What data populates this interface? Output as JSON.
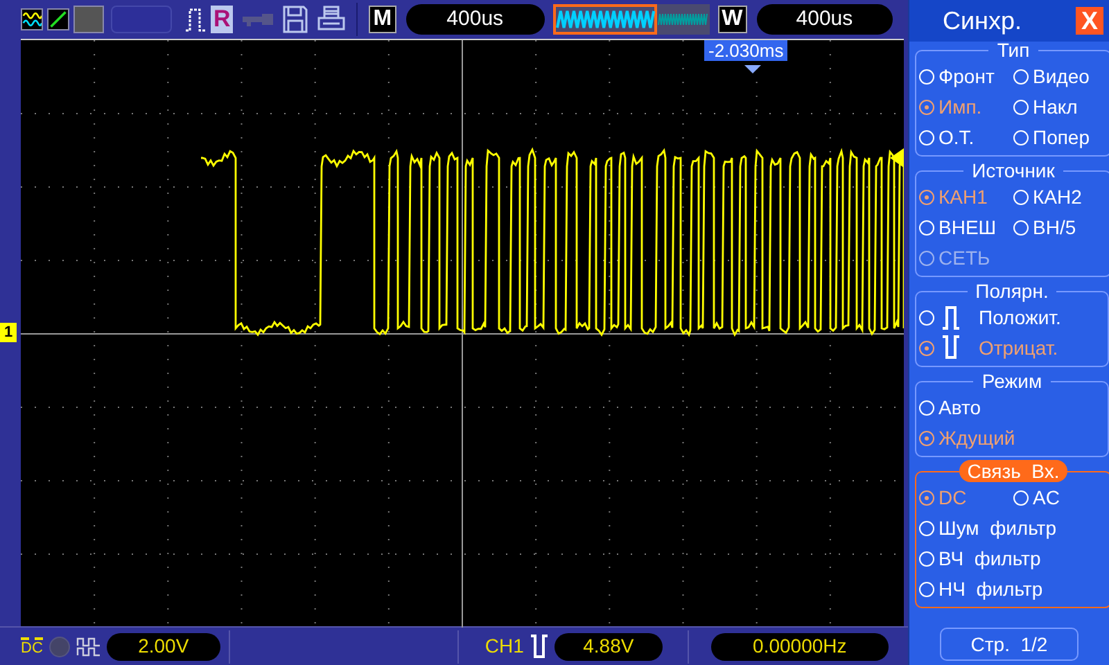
{
  "toolbar": {
    "ref_label": "R",
    "mode_label": "M",
    "time_base": "400us",
    "window_label": "W",
    "window_time": "400us"
  },
  "screen": {
    "trigger_position": "-2.030ms",
    "channel_marker": "1"
  },
  "trigger_panel": {
    "title": "Синхр.",
    "close": "X",
    "sections": [
      {
        "title": "Тип",
        "highlighted": false,
        "rows": [
          [
            {
              "label": "Фронт",
              "kind": "plain",
              "selected": false,
              "disabled": false
            },
            {
              "label": "Видео",
              "kind": "plain",
              "selected": false,
              "disabled": false
            }
          ],
          [
            {
              "label": "Имп.",
              "kind": "plain",
              "selected": true,
              "disabled": false
            },
            {
              "label": "Накл",
              "kind": "plain",
              "selected": false,
              "disabled": false
            }
          ],
          [
            {
              "label": "О.Т.",
              "kind": "plain",
              "selected": false,
              "disabled": false
            },
            {
              "label": "Попер",
              "kind": "plain",
              "selected": false,
              "disabled": false
            }
          ]
        ]
      },
      {
        "title": "Источник",
        "highlighted": false,
        "rows": [
          [
            {
              "label": "КАН1",
              "kind": "plain",
              "selected": true,
              "disabled": false
            },
            {
              "label": "КАН2",
              "kind": "plain",
              "selected": false,
              "disabled": false
            }
          ],
          [
            {
              "label": "ВНЕШ",
              "kind": "plain",
              "selected": false,
              "disabled": false
            },
            {
              "label": "ВН/5",
              "kind": "plain",
              "selected": false,
              "disabled": false
            }
          ],
          [
            {
              "label": "СЕТЬ",
              "kind": "plain",
              "selected": false,
              "disabled": true
            }
          ]
        ]
      },
      {
        "title": "Полярн.",
        "highlighted": false,
        "rows": [
          [
            {
              "label": "Положит.",
              "kind": "positive",
              "selected": false,
              "disabled": false
            }
          ],
          [
            {
              "label": "Отрицат.",
              "kind": "negative",
              "selected": true,
              "disabled": false
            }
          ]
        ]
      },
      {
        "title": "Режим",
        "highlighted": false,
        "rows": [
          [
            {
              "label": "Авто",
              "kind": "plain",
              "selected": false,
              "disabled": false
            }
          ],
          [
            {
              "label": "Ждущий",
              "kind": "plain",
              "selected": true,
              "disabled": false
            }
          ]
        ]
      },
      {
        "title": "Связь  Вх.",
        "highlighted": true,
        "rows": [
          [
            {
              "label": "DC",
              "kind": "plain",
              "selected": true,
              "disabled": false
            },
            {
              "label": "AC",
              "kind": "plain",
              "selected": false,
              "disabled": false
            }
          ],
          [
            {
              "label": "Шум  фильтр",
              "kind": "plain",
              "selected": false,
              "disabled": false
            }
          ],
          [
            {
              "label": "ВЧ  фильтр",
              "kind": "plain",
              "selected": false,
              "disabled": false
            }
          ],
          [
            {
              "label": "НЧ  фильтр",
              "kind": "plain",
              "selected": false,
              "disabled": false
            }
          ]
        ]
      }
    ],
    "page": "Стр.  1/2"
  },
  "status_bar": {
    "coupling": "DC",
    "volts_per_div": "2.00V",
    "trigger_source": "CH1",
    "trigger_level": "4.88V",
    "frequency": "0.00000Hz"
  }
}
